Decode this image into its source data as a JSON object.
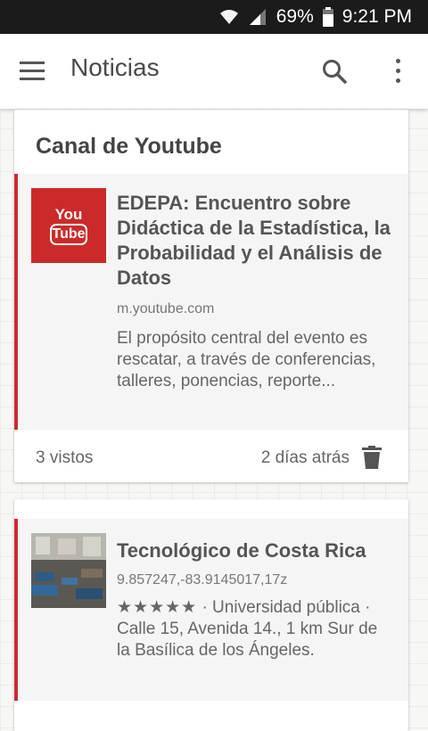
{
  "status_bar": {
    "battery": "69%",
    "time": "9:21 PM",
    "wifi_icon": "wifi-icon",
    "signal_icon": "signal-icon",
    "battery_icon": "battery-icon"
  },
  "app_bar": {
    "title": "Noticias",
    "menu_icon": "menu-icon",
    "search_icon": "search-icon",
    "more_icon": "more-vert-icon"
  },
  "cards": [
    {
      "header": "Canal de Youtube",
      "preview": {
        "logo_top": "You",
        "logo_bottom": "Tube",
        "title": "EDEPA: Encuentro sobre Didáctica de la Estadística, la Probabilidad y el Análisis de Datos",
        "domain": "m.youtube.com",
        "description": "El propósito central del evento es rescatar, a través de conferencias, talleres, ponencias, reporte..."
      },
      "footer": {
        "views": "3 vistos",
        "date": "2 días atrás",
        "delete_icon": "trash-icon"
      }
    },
    {
      "preview": {
        "title": "Tecnológico de Costa Rica",
        "domain": "9.857247,-83.9145017,17z",
        "stars": "★★★★★",
        "rating": 5,
        "description": "· Universidad pública · Calle 15, Avenida 14., 1 km Sur de la Basílica de los Ángeles."
      }
    }
  ],
  "colors": {
    "accent": "#cc2a36",
    "youtube": "#cc2a2a"
  }
}
